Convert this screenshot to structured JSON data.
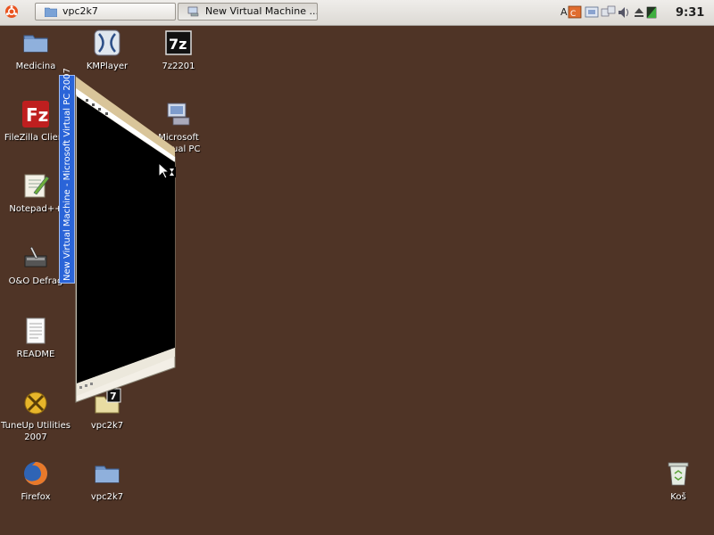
{
  "panel": {
    "tasks": [
      {
        "label": "vpc2k7",
        "icon": "folder-icon",
        "active": false
      },
      {
        "label": "New Virtual Machine ...",
        "icon": "virtual-pc-icon",
        "active": true
      }
    ],
    "tray_text": "A",
    "clock": "9:31"
  },
  "desktop": {
    "icons": [
      {
        "label": "Medicina",
        "icon": "folder-icon"
      },
      {
        "label": "KMPlayer",
        "icon": "kmplayer-icon"
      },
      {
        "label": "7z2201",
        "icon": "7zip-icon"
      },
      {
        "label": "FileZilla Client",
        "icon": "filezilla-icon"
      },
      {
        "label": "Microsoft",
        "label2": "Virtual PC",
        "icon": "virtual-pc-icon"
      },
      {
        "label": "Notepad++",
        "icon": "notepad-icon"
      },
      {
        "label": "O&O Defrag",
        "icon": "defrag-icon"
      },
      {
        "label": "README",
        "icon": "text-file-icon"
      },
      {
        "label": "TuneUp Utilities",
        "label2": "2007",
        "icon": "tuneup-icon"
      },
      {
        "label": "vpc2k7",
        "icon": "archive-icon"
      },
      {
        "label": "Firefox",
        "icon": "firefox-icon"
      },
      {
        "label": "vpc2k7",
        "icon": "folder-icon"
      },
      {
        "label": "Koš",
        "icon": "trash-icon"
      }
    ]
  },
  "vm_window": {
    "title": "New Virtual Machine - Microsoft Virtual PC 2007"
  },
  "colors": {
    "desktop": "#4f3426",
    "panel": "#e6e3df",
    "caption": "#2a64d8"
  }
}
